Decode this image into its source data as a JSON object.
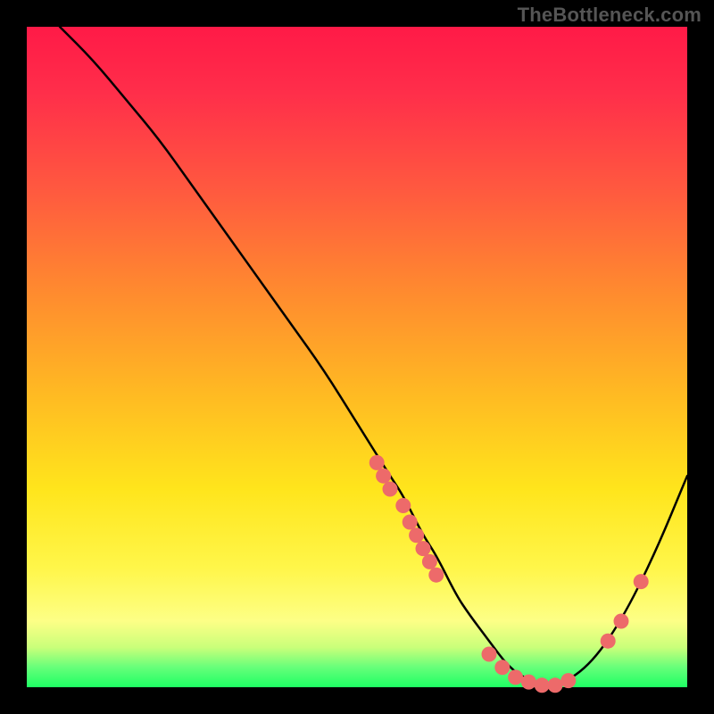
{
  "watermark": "TheBottleneck.com",
  "colors": {
    "background": "#000000",
    "curve": "#000000",
    "dot": "#ed6a6a",
    "gradient_top": "#ff1a47",
    "gradient_bottom": "#1eff64"
  },
  "chart_data": {
    "type": "line",
    "title": "",
    "xlabel": "",
    "ylabel": "",
    "xlim": [
      0,
      100
    ],
    "ylim": [
      0,
      100
    ],
    "grid": false,
    "legend": false,
    "series": [
      {
        "name": "bottleneck-curve",
        "x": [
          5,
          10,
          15,
          20,
          25,
          30,
          35,
          40,
          45,
          50,
          55,
          57,
          60,
          62,
          65,
          67,
          70,
          73,
          76,
          80,
          85,
          90,
          95,
          100
        ],
        "y": [
          100,
          95,
          89,
          83,
          76,
          69,
          62,
          55,
          48,
          40,
          32,
          29,
          23,
          20,
          14,
          11,
          7,
          3,
          1,
          0,
          3,
          10,
          20,
          32
        ]
      }
    ],
    "scatter": {
      "name": "highlight-points",
      "points": [
        {
          "x": 53,
          "y": 34
        },
        {
          "x": 54,
          "y": 32
        },
        {
          "x": 55,
          "y": 30
        },
        {
          "x": 57,
          "y": 27.5
        },
        {
          "x": 58,
          "y": 25
        },
        {
          "x": 59,
          "y": 23
        },
        {
          "x": 60,
          "y": 21
        },
        {
          "x": 61,
          "y": 19
        },
        {
          "x": 62,
          "y": 17
        },
        {
          "x": 70,
          "y": 5
        },
        {
          "x": 72,
          "y": 3
        },
        {
          "x": 74,
          "y": 1.5
        },
        {
          "x": 76,
          "y": 0.8
        },
        {
          "x": 78,
          "y": 0.3
        },
        {
          "x": 80,
          "y": 0.3
        },
        {
          "x": 82,
          "y": 1
        },
        {
          "x": 88,
          "y": 7
        },
        {
          "x": 90,
          "y": 10
        },
        {
          "x": 93,
          "y": 16
        }
      ]
    }
  }
}
